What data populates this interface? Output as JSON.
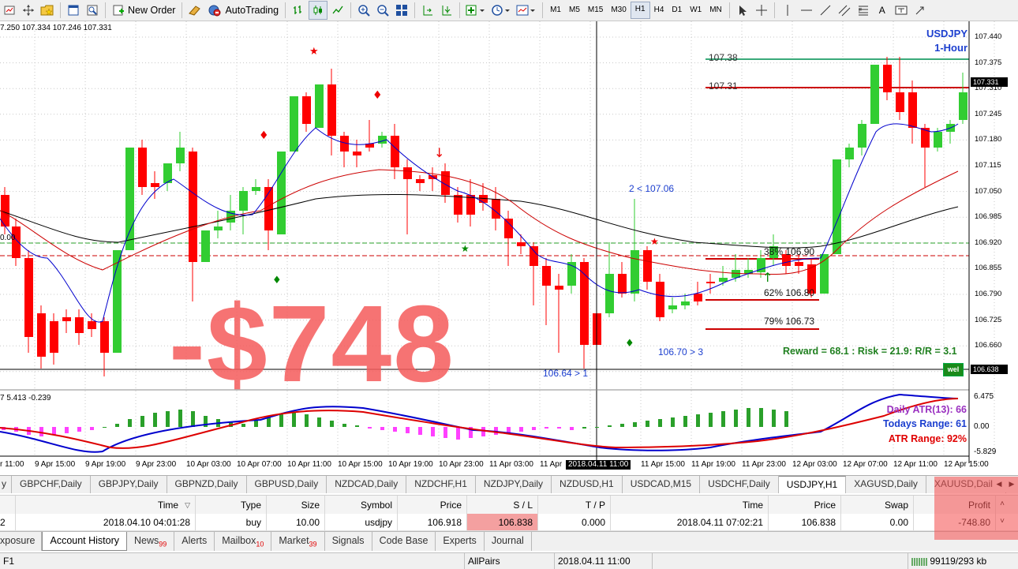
{
  "toolbar": {
    "new_order": "New Order",
    "autotrading": "AutoTrading",
    "timeframes": [
      "M1",
      "M5",
      "M15",
      "M30",
      "H1",
      "H4",
      "D1",
      "W1",
      "MN"
    ],
    "active_timeframe": "H1",
    "text_tool": "A"
  },
  "chart": {
    "ohlc_header": "7.250 107.334 107.246 107.331",
    "symbol": "USDJPY",
    "period": "1-Hour",
    "price_axis": [
      "107.440",
      "107.375",
      "107.310",
      "107.245",
      "107.180",
      "107.115",
      "107.050",
      "106.985",
      "106.920",
      "106.855",
      "106.790",
      "106.725",
      "106.660",
      "106.595"
    ],
    "current_price_label": "107.331",
    "low_price_label": "106.638",
    "left_level_label": "0.00",
    "level_top": "107.38",
    "level_second": "107.31",
    "fib_38": "38% 106.90",
    "fib_62": "62% 106.80",
    "fib_79": "79% 106.73",
    "swing_high_label": "2 < 107.06",
    "swing_low_right": "106.70 > 3",
    "swing_low_left": "106.64 > 1",
    "rr_text": "Reward = 68.1 : Risk = 21.9: R/R = 3.1",
    "wel_badge": "wel",
    "loss_overlay": "-$748",
    "indicator_header": "7 5.413 -0.239",
    "indicator_axis": [
      "6.475",
      "0.00",
      "-5.829"
    ],
    "daily_atr": "Daily ATR(13): 66",
    "todays_range": "Todays Range: 61",
    "atr_range": "ATR Range: 92%",
    "time_axis": [
      "r 11:00",
      "9 Apr 15:00",
      "9 Apr 19:00",
      "9 Apr 23:00",
      "10 Apr 03:00",
      "10 Apr 07:00",
      "10 Apr 11:00",
      "10 Apr 15:00",
      "10 Apr 19:00",
      "10 Apr 23:00",
      "11 Apr 03:00",
      "11 Apr",
      "11 Apr 15:00",
      "11 Apr 19:00",
      "11 Apr 23:00",
      "12 Apr 03:00",
      "12 Apr 07:00",
      "12 Apr 11:00",
      "12 Apr 15:00"
    ],
    "crosshair_time": "2018.04.11 11:00"
  },
  "chart_tabs": [
    "y",
    "GBPCHF,Daily",
    "GBPJPY,Daily",
    "GBPNZD,Daily",
    "GBPUSD,Daily",
    "NZDCAD,Daily",
    "NZDCHF,H1",
    "NZDJPY,Daily",
    "NZDUSD,H1",
    "USDCAD,M15",
    "USDCHF,Daily",
    "USDJPY,H1",
    "XAGUSD,Daily",
    "XAUUSD,Daily"
  ],
  "active_chart_tab": "USDJPY,H1",
  "history": {
    "headers": [
      "Time",
      "Type",
      "Size",
      "Symbol",
      "Price",
      "S / L",
      "T / P",
      "Time",
      "Price",
      "Swap",
      "Profit"
    ],
    "row": {
      "ticket": "2",
      "open_time": "2018.04.10 04:01:28",
      "type": "buy",
      "size": "10.00",
      "symbol": "usdjpy",
      "open_price": "106.918",
      "sl": "106.838",
      "tp": "0.000",
      "close_time": "2018.04.11 07:02:21",
      "close_price": "106.838",
      "swap": "0.00",
      "profit": "-748.80"
    }
  },
  "terminal_tabs": [
    {
      "label": "xposure",
      "count": ""
    },
    {
      "label": "Account History",
      "count": ""
    },
    {
      "label": "News",
      "count": "99"
    },
    {
      "label": "Alerts",
      "count": ""
    },
    {
      "label": "Mailbox",
      "count": "10"
    },
    {
      "label": "Market",
      "count": "39"
    },
    {
      "label": "Signals",
      "count": ""
    },
    {
      "label": "Code Base",
      "count": ""
    },
    {
      "label": "Experts",
      "count": ""
    },
    {
      "label": "Journal",
      "count": ""
    }
  ],
  "status": {
    "left": "F1",
    "profile": "AllPairs",
    "time": "2018.04.11 11:00",
    "traffic": "99119/293 kb"
  },
  "colors": {
    "bull": "#32cd32",
    "bear": "#ff0000",
    "loss_overlay": "#f45a5a",
    "ma_fast": "#0000cd",
    "ma_slow": "#000000",
    "ma_mid": "#cc0000"
  }
}
